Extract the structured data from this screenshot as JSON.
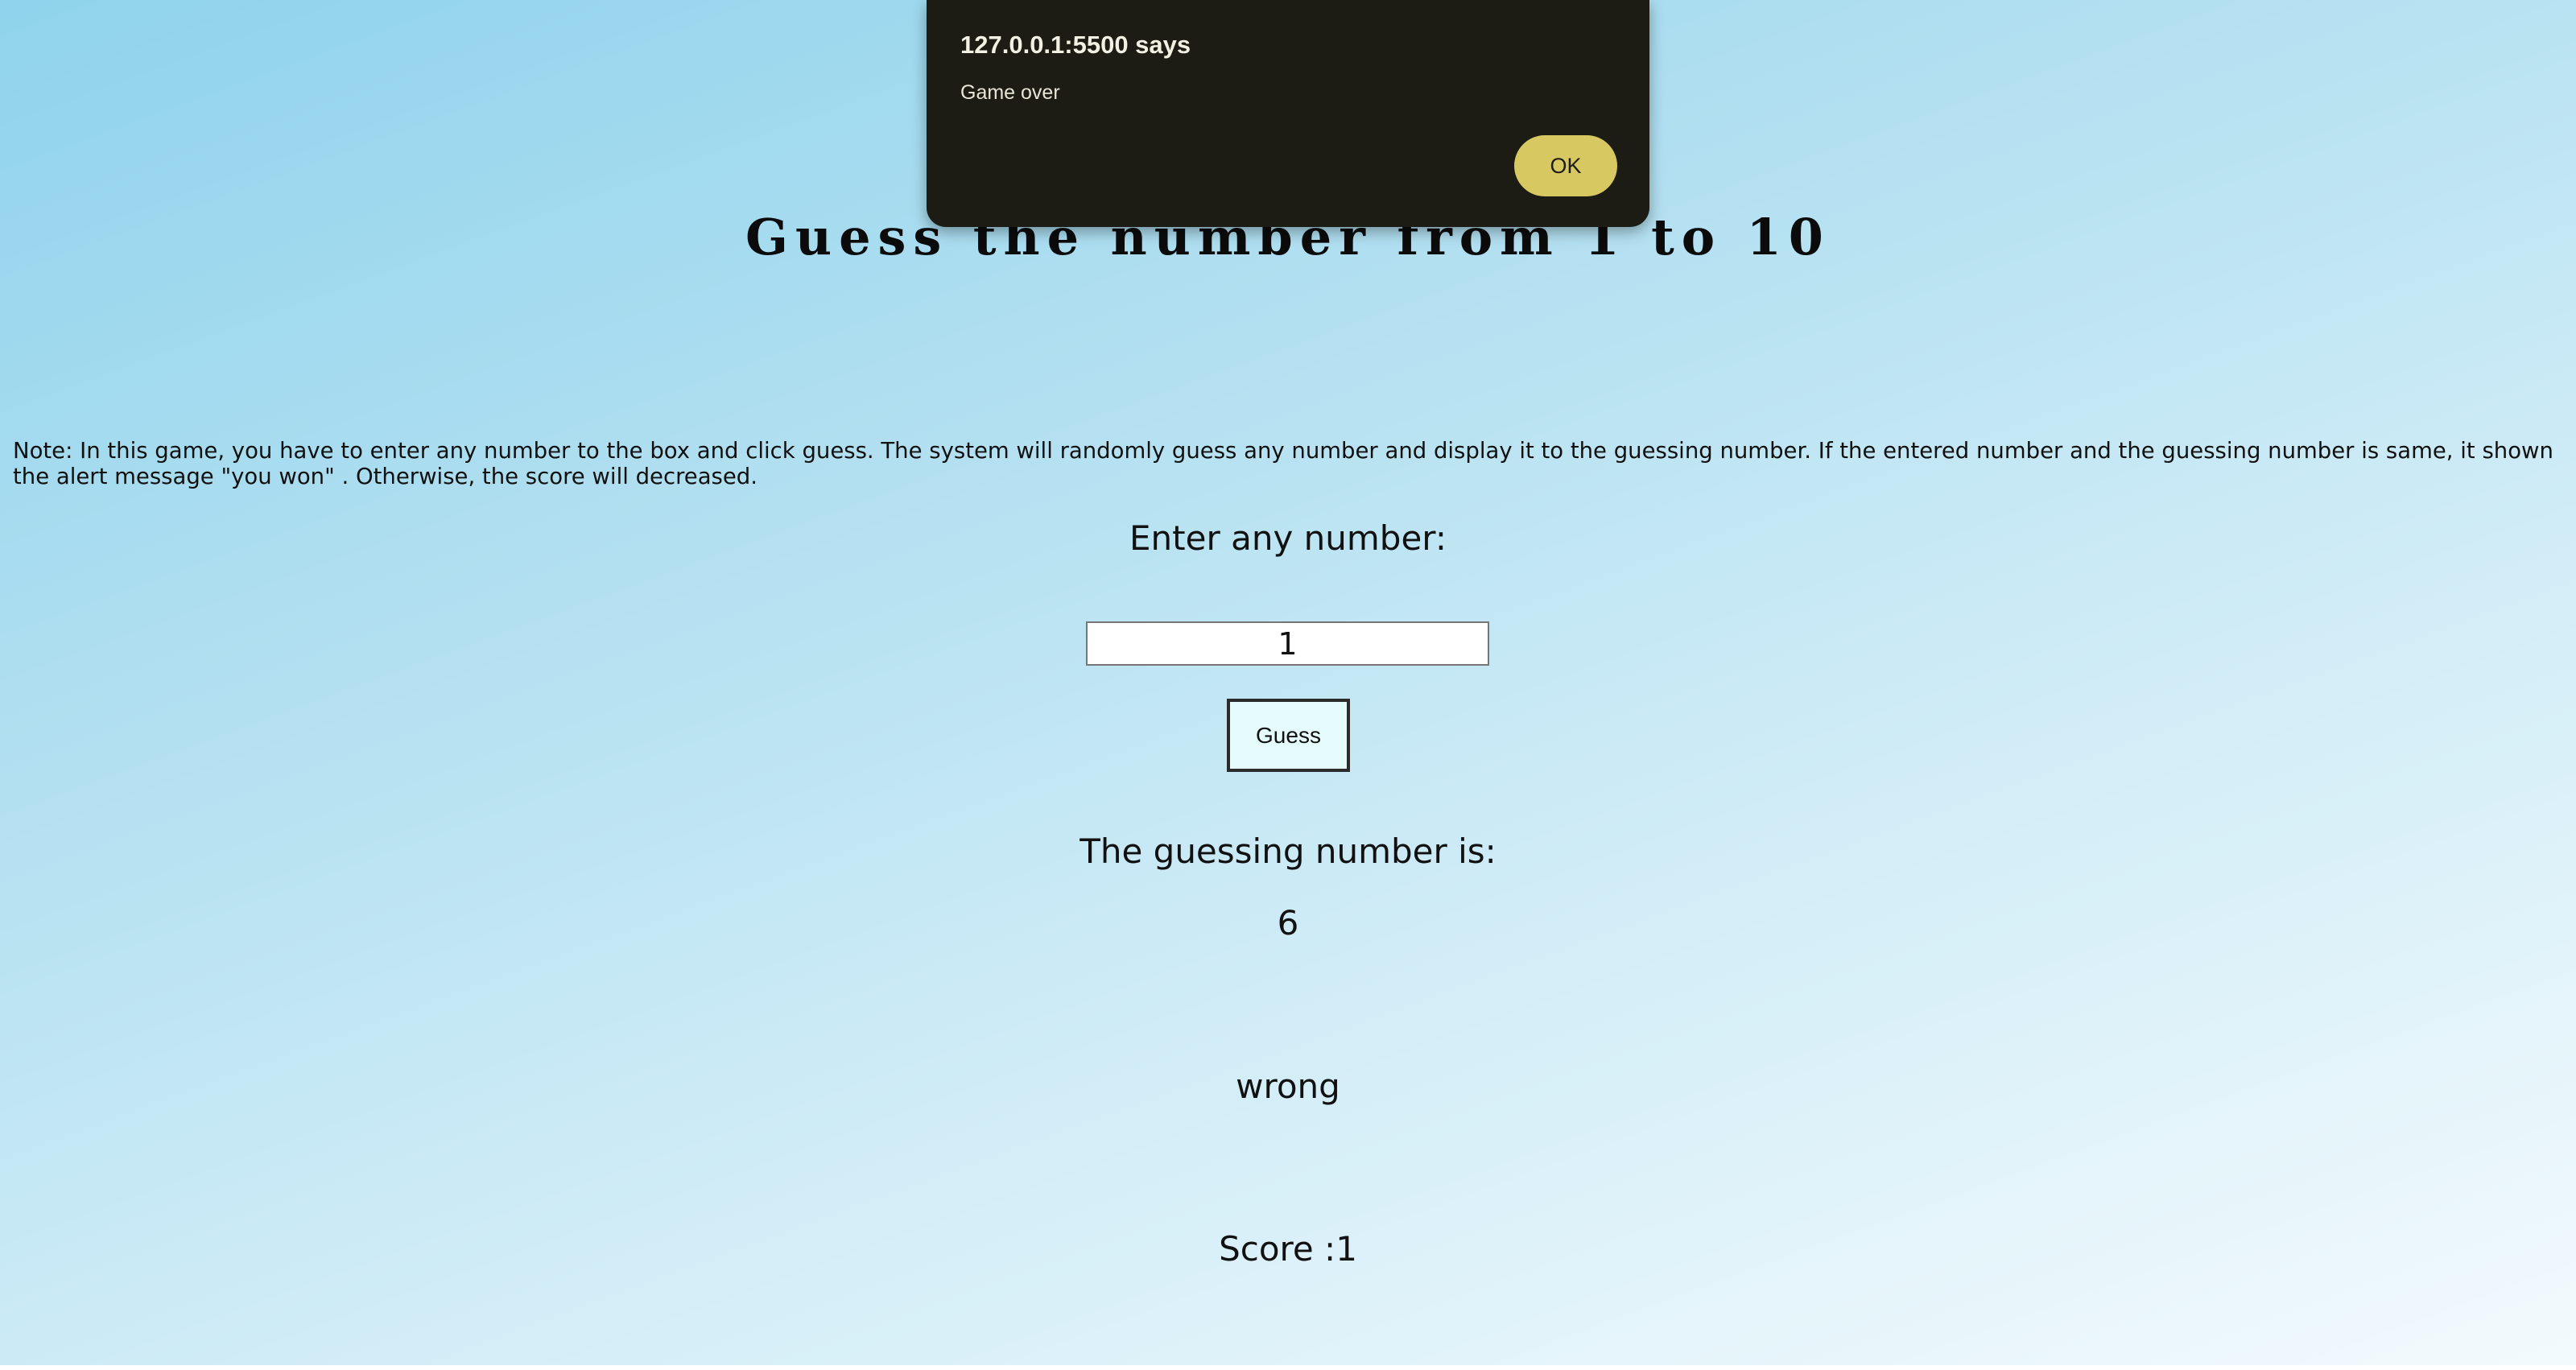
{
  "page": {
    "title": "Guess the number from 1 to 10",
    "note": "Note: In this game, you have to enter any number to the box and click guess. The system will randomly guess any number and display it to the guessing number. If the entered number and the guessing number is same, it shown the alert message \"you won\" . Otherwise, the score will decreased.",
    "enter_label": "Enter any number:",
    "input_value": "1",
    "guess_button_label": "Guess",
    "guessing_label": "The guessing number is:",
    "guessing_value": "6",
    "result": "wrong",
    "score": "Score :1"
  },
  "alert": {
    "title": "127.0.0.1:5500 says",
    "message": "Game over",
    "ok_label": "OK"
  },
  "colors": {
    "background_start": "#8fd3ec",
    "background_end": "#f3fafd",
    "dialog_background": "#1c1b14",
    "ok_button": "#d8c862",
    "guess_button": "#e6fbfb"
  }
}
